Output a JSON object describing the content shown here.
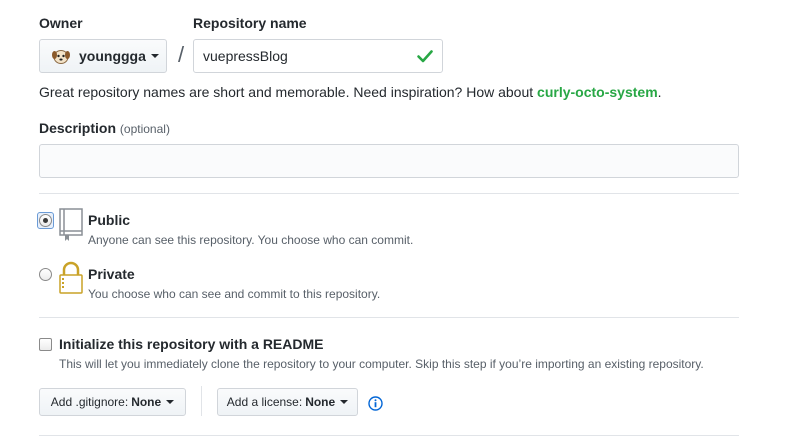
{
  "owner": {
    "label": "Owner",
    "name": "younggga"
  },
  "repository": {
    "label": "Repository name",
    "separator": "/",
    "value": "vuepressBlog"
  },
  "hint": {
    "prefix": "Great repository names are short and memorable. Need inspiration? How about ",
    "suggestion": "curly-octo-system",
    "suffix": "."
  },
  "description": {
    "label": "Description",
    "optional": "(optional)",
    "value": ""
  },
  "visibility": {
    "selected": "public",
    "options": [
      {
        "title": "Public",
        "note": "Anyone can see this repository. You choose who can commit."
      },
      {
        "title": "Private",
        "note": "You choose who can see and commit to this repository."
      }
    ]
  },
  "readme": {
    "checked": false,
    "title": "Initialize this repository with a README",
    "note": "This will let you immediately clone the repository to your computer. Skip this step if you’re importing an existing repository."
  },
  "gitignore": {
    "label": "Add .gitignore:",
    "value": "None"
  },
  "license": {
    "label": "Add a license:",
    "value": "None"
  },
  "colors": {
    "accent_green": "#28a745",
    "info_blue": "#0366d6",
    "border": "#d1d5da"
  }
}
